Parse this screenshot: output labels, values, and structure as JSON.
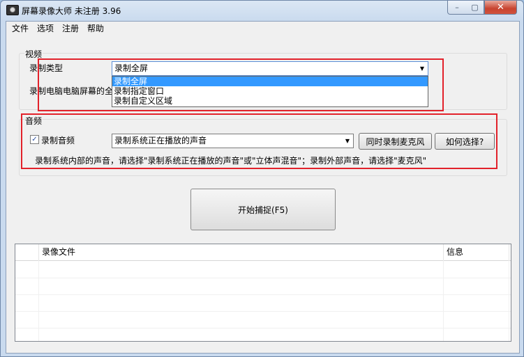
{
  "window": {
    "title": "屏幕录像大师 未注册 3.96",
    "controls": {
      "minimize": "–",
      "maximize": "▢",
      "close": "✕"
    }
  },
  "menu": [
    "文件",
    "选项",
    "注册",
    "帮助"
  ],
  "video": {
    "group_title": "视频",
    "record_type_label": "录制类型",
    "record_type_value": "录制全屏",
    "record_type_options": [
      "录制全屏",
      "录制指定窗口",
      "录制自定义区域"
    ],
    "hint_label": "录制电脑电脑屏幕的全"
  },
  "audio": {
    "group_title": "音频",
    "record_audio_label": "录制音频",
    "record_audio_checked": true,
    "source_value": "录制系统正在播放的声音",
    "mic_button": "同时录制麦克风",
    "howto_button": "如何选择?",
    "hint": "录制系统内部的声音，请选择\"录制系统正在播放的声音\"或\"立体声混音\"；录制外部声音，请选择\"麦克风\""
  },
  "start_button": "开始捕捉(F5)",
  "file_list": {
    "columns": [
      "录像文件",
      "信息"
    ]
  },
  "accent_colors": {
    "highlight_box": "#e2212a",
    "selection": "#3399ff"
  }
}
